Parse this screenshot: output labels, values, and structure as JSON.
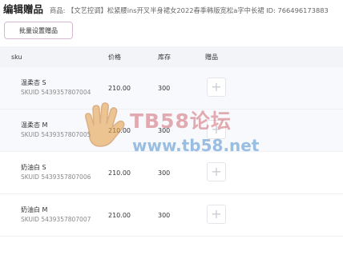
{
  "header": {
    "title": "编辑赠品",
    "product_line": "商品: 【文艺控调】松紧腰ins开叉半身裙女2022春季韩版宽松a字中长裙 ID: 766496173883"
  },
  "actions": {
    "batch_button": "批量设置赠品"
  },
  "table": {
    "headers": {
      "sku": "sku",
      "price": "价格",
      "stock": "库存",
      "gift": "赠品"
    },
    "rows": [
      {
        "name": "温柔杏 S",
        "skuid": "SKUID 5439357807004",
        "price": "210.00",
        "stock": "300"
      },
      {
        "name": "温柔杏 M",
        "skuid": "SKUID 5439357807005",
        "price": "210.00",
        "stock": "300"
      },
      {
        "name": "奶油白 S",
        "skuid": "SKUID 5439357807006",
        "price": "210.00",
        "stock": "300"
      },
      {
        "name": "奶油白 M",
        "skuid": "SKUID 5439357807007",
        "price": "210.00",
        "stock": "300"
      }
    ],
    "add_icon": "plus-icon"
  },
  "watermark": {
    "text": "TB58论坛",
    "url": "www.tb58.net"
  },
  "colors": {
    "button_border": "#d9b8d3",
    "header_bg": "#f3f4f7",
    "watermark_red": "#d06a73",
    "watermark_blue": "#4d8fce"
  }
}
